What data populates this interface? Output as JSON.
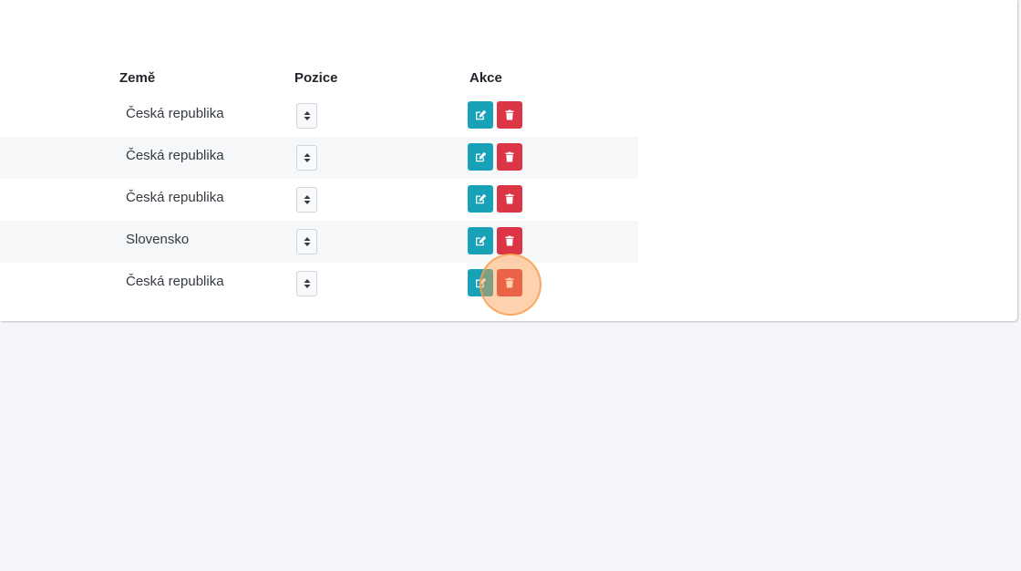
{
  "table": {
    "headers": {
      "country": "Země",
      "position": "Pozice",
      "actions": "Akce"
    },
    "rows": [
      {
        "country": "Česká republika"
      },
      {
        "country": "Česká republika"
      },
      {
        "country": "Česká republika"
      },
      {
        "country": "Slovensko"
      },
      {
        "country": "Česká republika"
      }
    ]
  },
  "colors": {
    "edit_button": "#17a2b8",
    "delete_button": "#dc3545",
    "row_stripe": "#f6f7f9",
    "page_background": "#f4f6f9",
    "click_marker": "#fd9b46"
  },
  "icons": {
    "position_select": "sort-icon",
    "edit": "edit-icon",
    "delete": "trash-icon"
  }
}
